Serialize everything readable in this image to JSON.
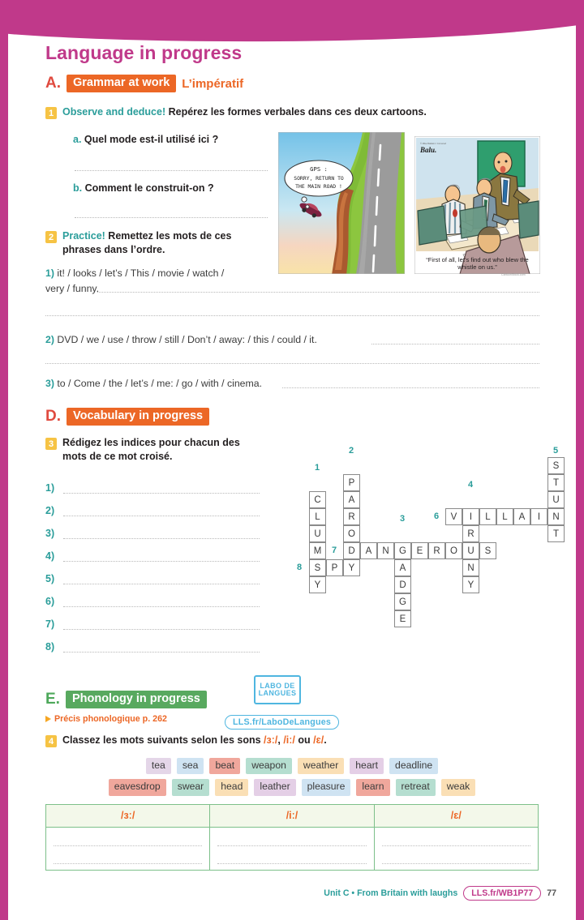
{
  "colors": {
    "magenta": "#c0398a",
    "orange": "#ec6726",
    "red": "#e04a3f",
    "teal": "#2a9d9a",
    "green": "#58a95f",
    "yellow": "#f6c344",
    "blue": "#4fb6e0"
  },
  "page_title": "Language in progress",
  "sections": {
    "A": {
      "letter": "A.",
      "tag": "Grammar at work",
      "subtitle": "L’impératif",
      "exercise1": {
        "num": "1",
        "en": "Observe and deduce!",
        "fr": "Repérez les formes verbales dans ces deux cartoons."
      },
      "questions": [
        {
          "label": "a.",
          "text": "Quel mode est-il utilisé ici ?"
        },
        {
          "label": "b.",
          "text": "Comment le construit-on ?"
        }
      ],
      "exercise2": {
        "num": "2",
        "en": "Practice!",
        "fr": "Remettez les mots de ces phrases dans l’ordre."
      },
      "sentences": [
        {
          "n": "1)",
          "line1": "it! / looks / let’s / This / movie / watch /",
          "line2": "very / funny."
        },
        {
          "n": "2)",
          "line1": "DVD / we / use / throw / still / Don’t / away: / this / could / it.",
          "line2": ""
        },
        {
          "n": "3)",
          "line1": "to / Come / the / let’s / me: / go / with / cinema.",
          "line2": ""
        }
      ]
    },
    "D": {
      "letter": "D.",
      "tag": "Vocabulary in progress",
      "exercise3": {
        "num": "3",
        "fr": "Rédigez les indices pour chacun des mots de ce mot croisé."
      },
      "clues": [
        "1)",
        "2)",
        "3)",
        "4)",
        "5)",
        "6)",
        "7)",
        "8)"
      ]
    },
    "E": {
      "letter": "E.",
      "tag": "Phonology in progress",
      "precis": "Précis phonologique p. 262",
      "labo_logo_line1": "LABO DE",
      "labo_logo_line2": "LANGUES",
      "labo_link": "LLS.fr/LaboDeLangues",
      "exercise4": {
        "num": "4",
        "text_before": "Classez les mots suivants selon les sons ",
        "s1": "/ɜː/",
        "sep1": ", ",
        "s2": "/iː/",
        "sep2": " ou ",
        "s3": "/ɛ/",
        "text_after": "."
      },
      "word_chips": [
        [
          {
            "word": "tea",
            "color": "#e4d6e8"
          },
          {
            "word": "sea",
            "color": "#cfe3f2"
          },
          {
            "word": "beat",
            "color": "#f0a79c"
          },
          {
            "word": "weapon",
            "color": "#b5ded0"
          },
          {
            "word": "weather",
            "color": "#fadfb5"
          },
          {
            "word": "heart",
            "color": "#e4cfe6"
          },
          {
            "word": "deadline",
            "color": "#cfe3f2"
          }
        ],
        [
          {
            "word": "eavesdrop",
            "color": "#f0a79c"
          },
          {
            "word": "swear",
            "color": "#b5ded0"
          },
          {
            "word": "head",
            "color": "#fadfb5"
          },
          {
            "word": "leather",
            "color": "#e4cfe6"
          },
          {
            "word": "pleasure",
            "color": "#cfe3f2"
          },
          {
            "word": "learn",
            "color": "#f0a79c"
          },
          {
            "word": "retreat",
            "color": "#b5ded0"
          },
          {
            "word": "weak",
            "color": "#fadfb5"
          }
        ]
      ],
      "sounds_table": {
        "headers": [
          "/ɜː/",
          "/iː/",
          "/ɛ/"
        ]
      }
    }
  },
  "cartoons": [
    {
      "name": "gps-cliff-cartoon",
      "speech_line1": "GPS :",
      "speech_line2": "SORRY, RETURN TO",
      "speech_line3": "THE MAIN ROAD !"
    },
    {
      "name": "boardroom-whistle-cartoon",
      "signature": "© Mike Baldwin / Cornered",
      "caption_line1": "“First of all, let’s find out who blew the",
      "caption_line2": "whistle on us.”",
      "credit": "CartoonStock.com"
    }
  ],
  "crossword": {
    "cell": 21,
    "cells": [
      {
        "r": 1,
        "c": 1,
        "ch": "C"
      },
      {
        "r": 2,
        "c": 1,
        "ch": "L"
      },
      {
        "r": 3,
        "c": 1,
        "ch": "U"
      },
      {
        "r": 4,
        "c": 1,
        "ch": "M"
      },
      {
        "r": 5,
        "c": 1,
        "ch": "S"
      },
      {
        "r": 6,
        "c": 1,
        "ch": "Y"
      },
      {
        "r": 5,
        "c": 2,
        "ch": "P"
      },
      {
        "r": 0,
        "c": 3,
        "ch": "P"
      },
      {
        "r": 1,
        "c": 3,
        "ch": "A"
      },
      {
        "r": 2,
        "c": 3,
        "ch": "R"
      },
      {
        "r": 3,
        "c": 3,
        "ch": "O"
      },
      {
        "r": 4,
        "c": 3,
        "ch": "D"
      },
      {
        "r": 5,
        "c": 3,
        "ch": "Y"
      },
      {
        "r": 4,
        "c": 4,
        "ch": "A"
      },
      {
        "r": 4,
        "c": 5,
        "ch": "N"
      },
      {
        "r": 4,
        "c": 6,
        "ch": "G"
      },
      {
        "r": 5,
        "c": 6,
        "ch": "A"
      },
      {
        "r": 6,
        "c": 6,
        "ch": "D"
      },
      {
        "r": 7,
        "c": 6,
        "ch": "G"
      },
      {
        "r": 8,
        "c": 6,
        "ch": "E"
      },
      {
        "r": 4,
        "c": 7,
        "ch": "E"
      },
      {
        "r": 4,
        "c": 8,
        "ch": "R"
      },
      {
        "r": 2,
        "c": 9,
        "ch": "V"
      },
      {
        "r": 2,
        "c": 10,
        "ch": "I"
      },
      {
        "r": 3,
        "c": 10,
        "ch": "R"
      },
      {
        "r": 4,
        "c": 9,
        "ch": "O"
      },
      {
        "r": 4,
        "c": 10,
        "ch": "U"
      },
      {
        "r": 4,
        "c": 11,
        "ch": "S"
      },
      {
        "r": 5,
        "c": 10,
        "ch": "N"
      },
      {
        "r": 6,
        "c": 10,
        "ch": "Y"
      },
      {
        "r": 2,
        "c": 11,
        "ch": "L"
      },
      {
        "r": 2,
        "c": 12,
        "ch": "L"
      },
      {
        "r": 2,
        "c": 13,
        "ch": "A"
      },
      {
        "r": 2,
        "c": 14,
        "ch": "I"
      },
      {
        "r": 0,
        "c": 15,
        "ch": "S"
      },
      {
        "r": 1,
        "c": 15,
        "ch": "T"
      },
      {
        "r": 2,
        "c": 15,
        "ch": "U"
      },
      {
        "r": 2,
        "c": 15,
        "ch": "N"
      },
      {
        "r": 3,
        "c": 15,
        "ch": "T"
      }
    ],
    "column_grid": [
      {
        "label": "C",
        "col": 1,
        "row": 1
      }
    ],
    "numbers": [
      {
        "n": "1",
        "r": -1,
        "c": 1,
        "side": "top"
      },
      {
        "n": "2",
        "r": -1,
        "c": 3,
        "side": "top"
      },
      {
        "n": "3",
        "r": 3,
        "c": 6,
        "side": "top"
      },
      {
        "n": "4",
        "r": 1,
        "c": 10,
        "side": "top"
      },
      {
        "n": "5",
        "r": -1,
        "c": 15,
        "side": "top"
      },
      {
        "n": "6",
        "r": 2,
        "c": 8,
        "side": "left"
      },
      {
        "n": "7",
        "r": 4,
        "c": 2,
        "side": "cell"
      },
      {
        "n": "8",
        "r": 5,
        "c": 0,
        "side": "left"
      }
    ],
    "words": {
      "across": [
        {
          "n": "7",
          "answer": "DANGEROUS"
        },
        {
          "n": "8",
          "answer": "SPY"
        },
        {
          "n": "6",
          "answer": "VILLAIN"
        }
      ],
      "down": [
        {
          "n": "1",
          "answer": "CLUMSY"
        },
        {
          "n": "2",
          "answer": "PARODY"
        },
        {
          "n": "3",
          "answer": "GADGE"
        },
        {
          "n": "4",
          "answer": "IRONY"
        },
        {
          "n": "5",
          "answer": "STUNT"
        }
      ]
    }
  },
  "footer": {
    "unit": "Unit C • From Britain with laughs",
    "code": "LLS.fr/WB1P77",
    "page": "77"
  }
}
